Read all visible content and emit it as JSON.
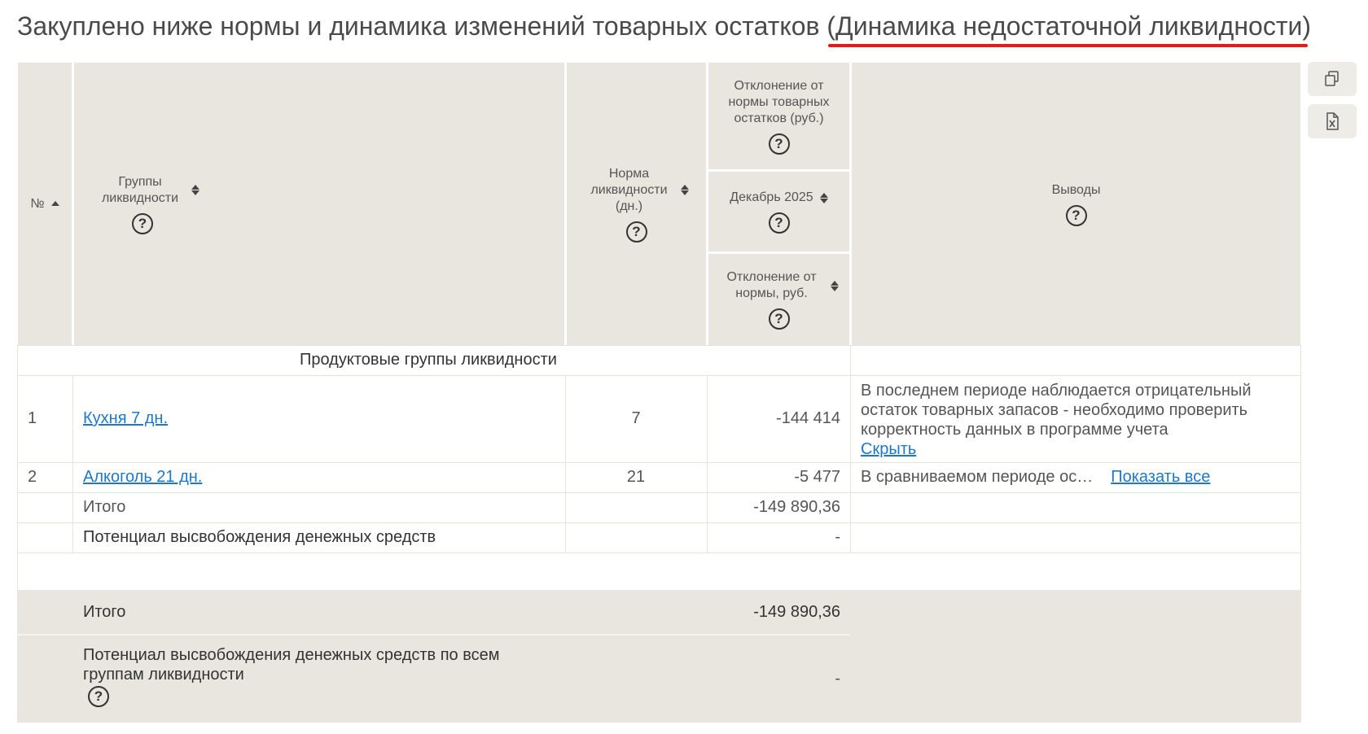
{
  "title_main": "Закуплено ниже нормы и динамика изменений товарных остатков ",
  "title_highlight": "(Динамика недостаточной ликвидности)",
  "headers": {
    "num": "№",
    "groups": "Группы ликвидности",
    "norm": "Норма ликвидности (дн.)",
    "dev_norm": "Отклонение от нормы товарных остатков (руб.)",
    "period": "Декабрь 2025",
    "dev_rub": "Отклонение от нормы, руб.",
    "conclusions": "Выводы"
  },
  "section_label": "Продуктовые группы ликвидности",
  "rows": [
    {
      "num": "1",
      "group": "Кухня 7 дн.",
      "norm": "7",
      "value": "-144 414",
      "conclusion": "В последнем периоде наблюдается отрицательный остаток товарных запасов - необходимо проверить корректность данных в программе учета",
      "action": "Скрыть"
    },
    {
      "num": "2",
      "group": "Алкоголь 21 дн.",
      "norm": "21",
      "value": "-5 477",
      "conclusion": "В сравниваемом периоде ос…",
      "action": "Показать все"
    }
  ],
  "subtotal": {
    "label": "Итого",
    "value": "-149 890,36"
  },
  "potential": {
    "label": "Потенциал высвобождения денежных средств",
    "value": "-"
  },
  "footer": {
    "total_label": "Итого",
    "total_value": "-149 890,36",
    "potential_label": "Потенциал высвобождения денежных средств по всем группам ликвидности",
    "potential_value": "-"
  },
  "toolbar": {
    "copy_icon": "copy-icon",
    "excel_icon": "excel-icon"
  }
}
